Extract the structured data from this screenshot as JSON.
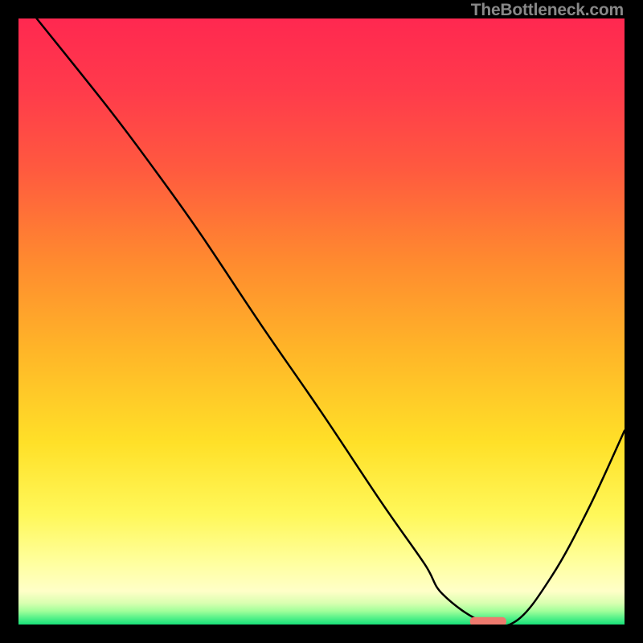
{
  "watermark": "TheBottleneck.com",
  "chart_data": {
    "type": "line",
    "title": "",
    "xlabel": "",
    "ylabel": "",
    "xlim": [
      0,
      100
    ],
    "ylim": [
      0,
      100
    ],
    "grid": false,
    "legend": false,
    "background_gradient": {
      "stops": [
        {
          "pos": 0.0,
          "color": "#ff2850"
        },
        {
          "pos": 0.12,
          "color": "#ff3b4b"
        },
        {
          "pos": 0.25,
          "color": "#ff5a3f"
        },
        {
          "pos": 0.4,
          "color": "#ff8a2f"
        },
        {
          "pos": 0.55,
          "color": "#ffb628"
        },
        {
          "pos": 0.7,
          "color": "#ffe028"
        },
        {
          "pos": 0.82,
          "color": "#fff85a"
        },
        {
          "pos": 0.9,
          "color": "#ffffa0"
        },
        {
          "pos": 0.945,
          "color": "#ffffc8"
        },
        {
          "pos": 0.965,
          "color": "#d8ffb0"
        },
        {
          "pos": 0.978,
          "color": "#a0ff9a"
        },
        {
          "pos": 0.99,
          "color": "#50f088"
        },
        {
          "pos": 1.0,
          "color": "#18e078"
        }
      ]
    },
    "series": [
      {
        "name": "bottleneck-curve",
        "x": [
          3.0,
          15.0,
          22.5,
          30.0,
          40.0,
          50.0,
          60.0,
          67.0,
          70.0,
          76.5,
          82.0,
          88.0,
          94.0,
          100.0
        ],
        "y": [
          100.0,
          85.0,
          75.0,
          64.5,
          49.5,
          35.0,
          20.0,
          10.0,
          5.0,
          0.5,
          0.5,
          8.0,
          19.0,
          32.0
        ]
      }
    ],
    "marker": {
      "name": "optimal-range",
      "x_start": 74.5,
      "x_end": 80.5,
      "y": 0.5,
      "color": "#ee7a6e"
    }
  }
}
